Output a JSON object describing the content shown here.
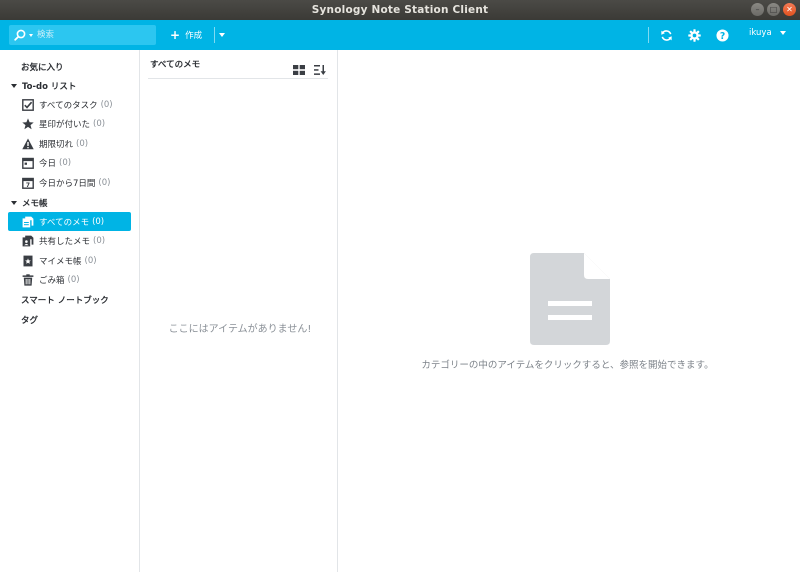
{
  "window": {
    "title": "Synology Note Station Client"
  },
  "toolbar": {
    "search_placeholder": "検索",
    "create_label": "作成",
    "user": "ikuya"
  },
  "sidebar": {
    "favorites": "お気に入り",
    "todo_section": "To-do リスト",
    "todo_items": [
      {
        "label": "すべてのタスク",
        "count": "(0)"
      },
      {
        "label": "星印が付いた",
        "count": "(0)"
      },
      {
        "label": "期限切れ",
        "count": "(0)"
      },
      {
        "label": "今日",
        "count": "(0)"
      },
      {
        "label": "今日から7日間",
        "count": "(0)"
      }
    ],
    "notebook_section": "メモ帳",
    "notebook_items": [
      {
        "label": "すべてのメモ",
        "count": "(0)"
      },
      {
        "label": "共有したメモ",
        "count": "(0)"
      },
      {
        "label": "マイメモ帳",
        "count": "(0)"
      },
      {
        "label": "ごみ箱",
        "count": "(0)"
      }
    ],
    "smart_notebook": "スマート ノートブック",
    "tags": "タグ"
  },
  "list": {
    "title": "すべてのメモ",
    "empty": "ここにはアイテムがありません!"
  },
  "detail": {
    "message": "カテゴリーの中のアイテムをクリックすると、参照を開始できます。"
  },
  "colors": {
    "accent": "#00b4e5",
    "title_bar": "#3f3e3a",
    "doc_icon": "#d3d6d9"
  }
}
